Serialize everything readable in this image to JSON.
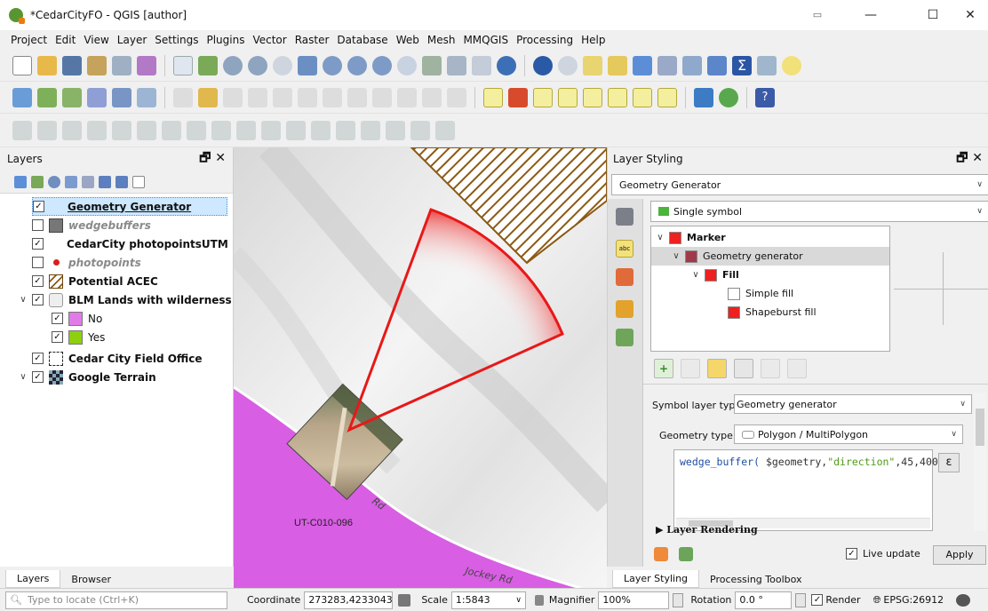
{
  "window": {
    "title": "*CedarCityFO - QGIS [author]"
  },
  "menu": [
    "Project",
    "Edit",
    "View",
    "Layer",
    "Settings",
    "Plugins",
    "Vector",
    "Raster",
    "Database",
    "Web",
    "Mesh",
    "MMQGIS",
    "Processing",
    "Help"
  ],
  "layers_panel": {
    "title": "Layers",
    "layers": [
      {
        "label": "Geometry Generator",
        "checked": true
      },
      {
        "label": "wedgebuffers",
        "checked": false
      },
      {
        "label": "CedarCity photopointsUTM",
        "checked": true
      },
      {
        "label": "photopoints",
        "checked": false
      },
      {
        "label": "Potential ACEC",
        "checked": true
      },
      {
        "label": "BLM Lands with wilderness ...",
        "checked": true
      },
      {
        "label": "No",
        "checked": true,
        "color": "#e07be8"
      },
      {
        "label": "Yes",
        "checked": true,
        "color": "#8ecf10"
      },
      {
        "label": "Cedar City Field Office",
        "checked": true
      },
      {
        "label": "Google Terrain",
        "checked": true
      }
    ],
    "tabs": [
      "Layers",
      "Browser"
    ]
  },
  "map": {
    "labels": {
      "road1": "Rd",
      "area": "UT-C010-096",
      "road2": "Jockey Rd"
    },
    "colors": {
      "wilderness_no": "#d85ee3",
      "wedge": "#ee2020"
    }
  },
  "styling_panel": {
    "title": "Layer Styling",
    "layer": "Geometry Generator",
    "renderer": "Single symbol",
    "tree": {
      "marker": "Marker",
      "geometry_generator": "Geometry generator",
      "fill": "Fill",
      "simple_fill": "Simple fill",
      "shapeburst_fill": "Shapeburst fill"
    },
    "symbol_layer_type_label": "Symbol layer type",
    "symbol_layer_type_value": "Geometry generator",
    "geometry_type_label": "Geometry type",
    "geometry_type_value": "Polygon / MultiPolygon",
    "expression": {
      "func": "wedge_buffer( ",
      "var": "$geometry",
      "sep1": ",",
      "str": "\"direction\"",
      "rest": ",45,400)"
    },
    "expr_button": "ε",
    "layer_rendering": "Layer Rendering",
    "live_update": "Live update",
    "live_update_checked": true,
    "apply": "Apply",
    "tabs": [
      "Layer Styling",
      "Processing Toolbox"
    ]
  },
  "statusbar": {
    "search_placeholder": "Type to locate (Ctrl+K)",
    "coordinate_label": "Coordinate",
    "coordinate_value": "273283,4233043",
    "scale_label": "Scale",
    "scale_value": "1:5843",
    "magnifier_label": "Magnifier",
    "magnifier_value": "100%",
    "rotation_label": "Rotation",
    "rotation_value": "0.0 °",
    "render_label": "Render",
    "crs": "EPSG:26912"
  }
}
